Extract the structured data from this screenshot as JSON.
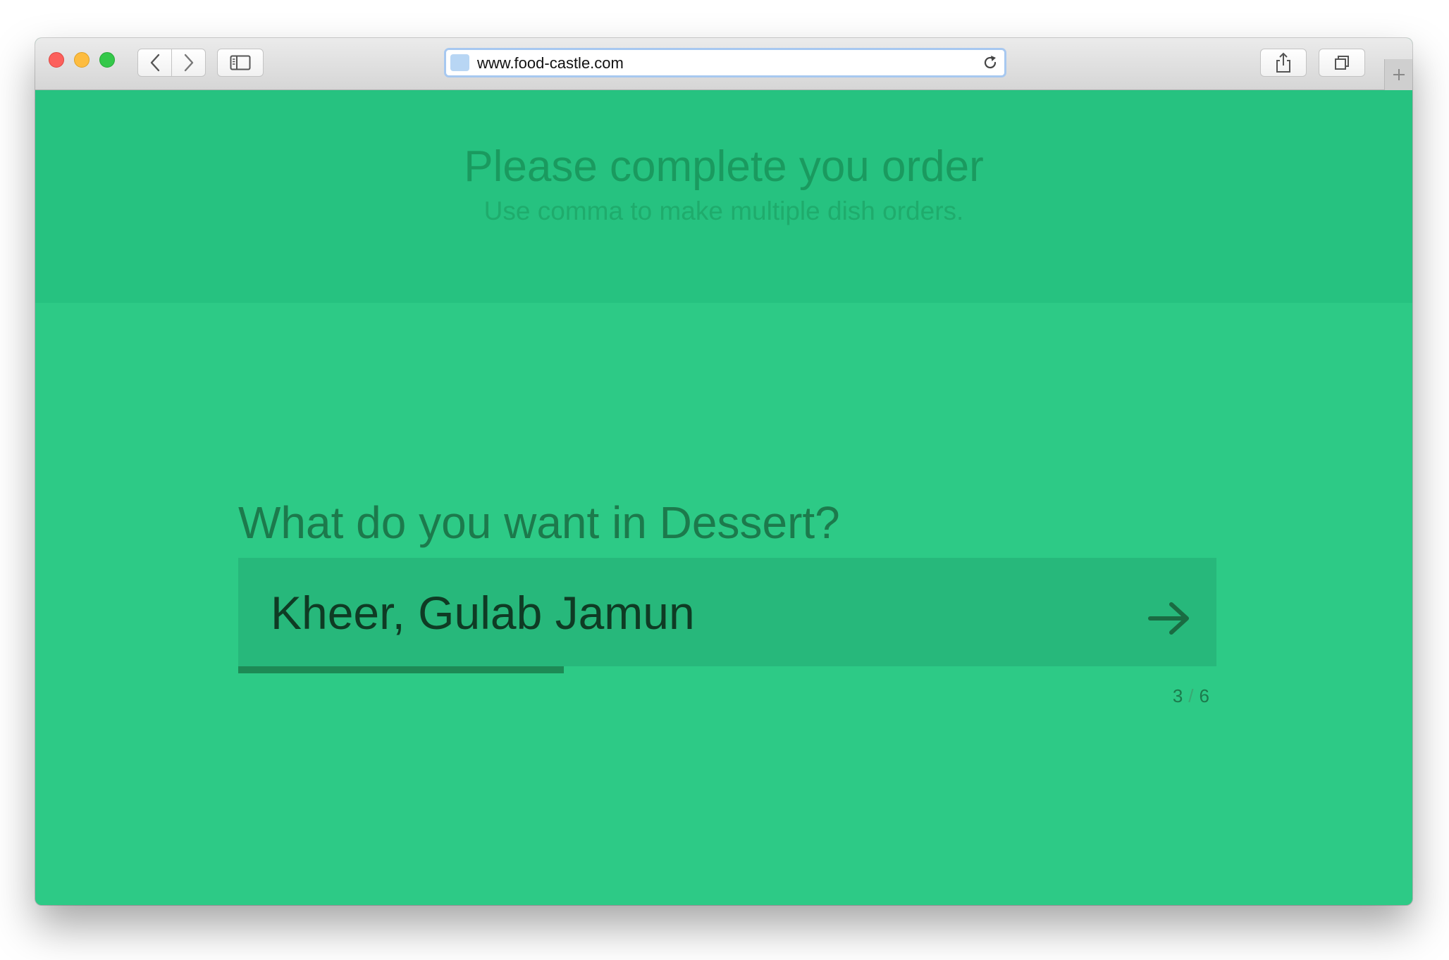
{
  "browser": {
    "url": "www.food-castle.com",
    "icons": {
      "back": "chevron-left-icon",
      "forward": "chevron-right-icon",
      "sidebar": "sidebar-icon",
      "reload": "reload-icon",
      "share": "share-icon",
      "tabs": "tabs-overview-icon",
      "new_tab": "plus-icon"
    }
  },
  "page": {
    "title": "Please complete you order",
    "subtitle": "Use comma to make multiple dish orders."
  },
  "form": {
    "question": "What do you want in Dessert?",
    "answer": "Kheer, Gulab Jamun",
    "submit_icon": "arrow-right-icon",
    "progress": {
      "current": "3",
      "separator": "/",
      "total": "6",
      "fraction": 0.333
    }
  },
  "colors": {
    "background": "#2dca86",
    "header_band": "#26c280",
    "input_background": "#27b87b",
    "progress_fill": "#1d8a55",
    "heading_text": "#1c7a4c"
  }
}
